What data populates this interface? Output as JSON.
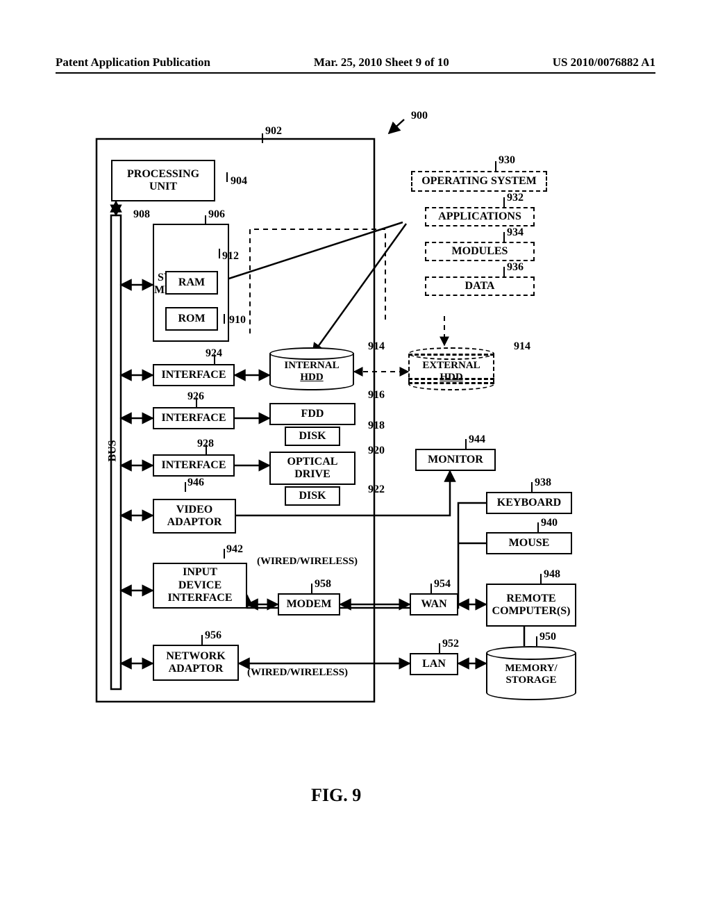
{
  "header": {
    "left": "Patent Application Publication",
    "mid": "Mar. 25, 2010  Sheet 9 of 10",
    "right": "US 2010/0076882 A1"
  },
  "figure_label": "FIG. 9",
  "refs": {
    "r900": "900",
    "r902": "902",
    "r904": "904",
    "r906": "906",
    "r908": "908",
    "r910": "910",
    "r912": "912",
    "r914a": "914",
    "r914b": "914",
    "r916": "916",
    "r918": "918",
    "r920": "920",
    "r922": "922",
    "r924": "924",
    "r926": "926",
    "r928": "928",
    "r930": "930",
    "r932": "932",
    "r934": "934",
    "r936": "936",
    "r938": "938",
    "r940": "940",
    "r942": "942",
    "r944": "944",
    "r946": "946",
    "r948": "948",
    "r950": "950",
    "r952": "952",
    "r954": "954",
    "r956": "956",
    "r958": "958"
  },
  "blocks": {
    "pu": "PROCESSING\nUNIT",
    "sysmem": "SYSTEM\nMEMORY",
    "ram": "RAM",
    "rom": "ROM",
    "if1": "INTERFACE",
    "if2": "INTERFACE",
    "if3": "INTERFACE",
    "video": "VIDEO\nADAPTOR",
    "inputdev": "INPUT\nDEVICE\nINTERFACE",
    "netadp": "NETWORK\nADAPTOR",
    "ihdd_l1": "INTERNAL",
    "ihdd_l2": "HDD",
    "ehdd_l1": "EXTERNAL",
    "ehdd_l2": "HDD",
    "fdd": "FDD",
    "disk1": "DISK",
    "opt": "OPTICAL\nDRIVE",
    "disk2": "DISK",
    "mon": "MONITOR",
    "kb": "KEYBOARD",
    "mouse": "MOUSE",
    "modem": "MODEM",
    "wan": "WAN",
    "lan": "LAN",
    "remote": "REMOTE\nCOMPUTER(S)",
    "memstor_l1": "MEMORY/",
    "memstor_l2": "STORAGE",
    "os": "OPERATING SYSTEM",
    "apps": "APPLICATIONS",
    "mods": "MODULES",
    "data": "DATA",
    "bus": "BUS"
  },
  "annot": {
    "ww1": "(WIRED/WIRELESS)",
    "ww2": "(WIRED/WIRELESS)"
  }
}
